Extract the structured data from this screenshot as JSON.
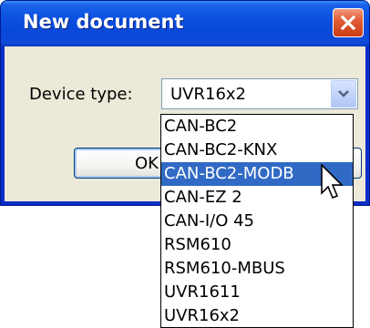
{
  "window": {
    "title": "New document",
    "close_icon": "close-icon"
  },
  "form": {
    "device_label": "Device type:",
    "device_value": "UVR16x2",
    "dropdown_icon": "chevron-down-icon",
    "ok_label": "OK",
    "cancel_label": ""
  },
  "dropdown": {
    "items": [
      "CAN-BC2",
      "CAN-BC2-KNX",
      "CAN-BC2-MODB",
      "CAN-EZ 2",
      "CAN-I/O 45",
      "RSM610",
      "RSM610-MBUS",
      "UVR1611",
      "UVR16x2"
    ],
    "highlighted": "CAN-BC2-MODB"
  },
  "colors": {
    "titlebar": "#0a48d8",
    "client": "#ece9d8",
    "selection": "#316ac5",
    "close": "#c93d12"
  },
  "cursor_icon": "mouse-pointer-icon"
}
